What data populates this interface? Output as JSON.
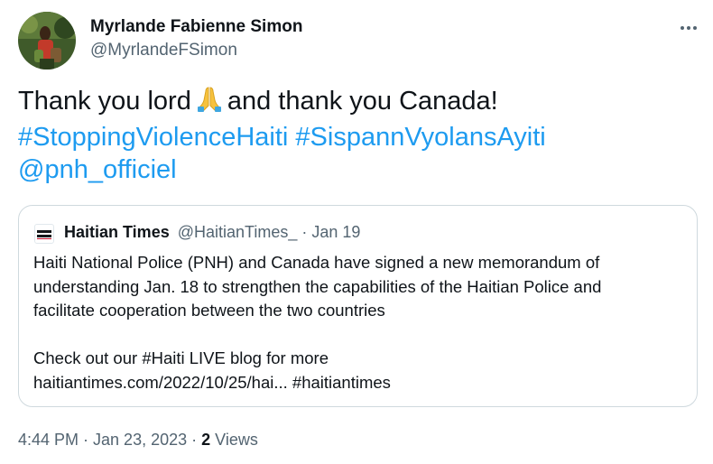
{
  "author": {
    "name": "Myrlande Fabienne Simon",
    "handle": "@MyrlandeFSimon"
  },
  "tweet": {
    "text_part1": "Thank you lord",
    "emoji": "folded-hands-emoji",
    "text_part2": "and thank you Canada!",
    "hashtag1": "#StoppingViolenceHaiti",
    "hashtag2": "#SispannVyolansAyiti",
    "mention": "@pnh_officiel"
  },
  "quote": {
    "avatar_text": "HAITIAN TIMES",
    "name": "Haitian Times",
    "handle": "@HaitianTimes_",
    "date": "· Jan 19",
    "lines": [
      "Haiti National Police (PNH) and Canada have signed a new memorandum of",
      "understanding Jan. 18 to strengthen the capabilities of the Haitian Police and",
      "facilitate cooperation between the two countries",
      "",
      "Check out our #Haiti LIVE blog for more",
      "haitiantimes.com/2022/10/25/hai... #haitiantimes"
    ]
  },
  "meta": {
    "timestamp": "4:44 PM · Jan 23, 2023 ·",
    "views_count": "2",
    "views_label": "Views"
  },
  "colors": {
    "link": "#1d9bf0",
    "secondary_text": "#536471",
    "border": "#cfd9de"
  }
}
